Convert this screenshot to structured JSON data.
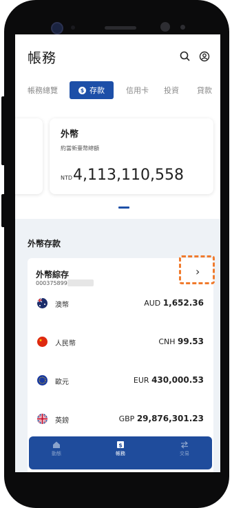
{
  "header": {
    "title": "帳務"
  },
  "tabs": {
    "items": [
      "帳務總覽",
      "存款",
      "信用卡",
      "投資",
      "貸款"
    ],
    "active_index": 1
  },
  "fx_card": {
    "title": "外幣",
    "subtitle": "約當新臺幣總額",
    "currency": "NTD",
    "amount": "4,113,110,558"
  },
  "section": {
    "title": "外幣存款"
  },
  "account": {
    "name": "外幣綜存",
    "number": "000375899"
  },
  "currencies": [
    {
      "name": "澳幣",
      "code": "AUD",
      "amount": "1,652.36",
      "flag": "australia-flag-icon"
    },
    {
      "name": "人民幣",
      "code": "CNH",
      "amount": "99.53",
      "flag": "china-flag-icon"
    },
    {
      "name": "歐元",
      "code": "EUR",
      "amount": "430,000.53",
      "flag": "eu-flag-icon"
    },
    {
      "name": "英鎊",
      "code": "GBP",
      "amount": "29,876,301.23",
      "flag": "uk-flag-icon"
    }
  ],
  "bottom_nav": {
    "items": [
      "動態",
      "帳務",
      "交易"
    ],
    "active_index": 1
  },
  "colors": {
    "primary": "#1d4fa8",
    "nav_bg": "#1f4c9c",
    "highlight": "#f07a2c"
  }
}
